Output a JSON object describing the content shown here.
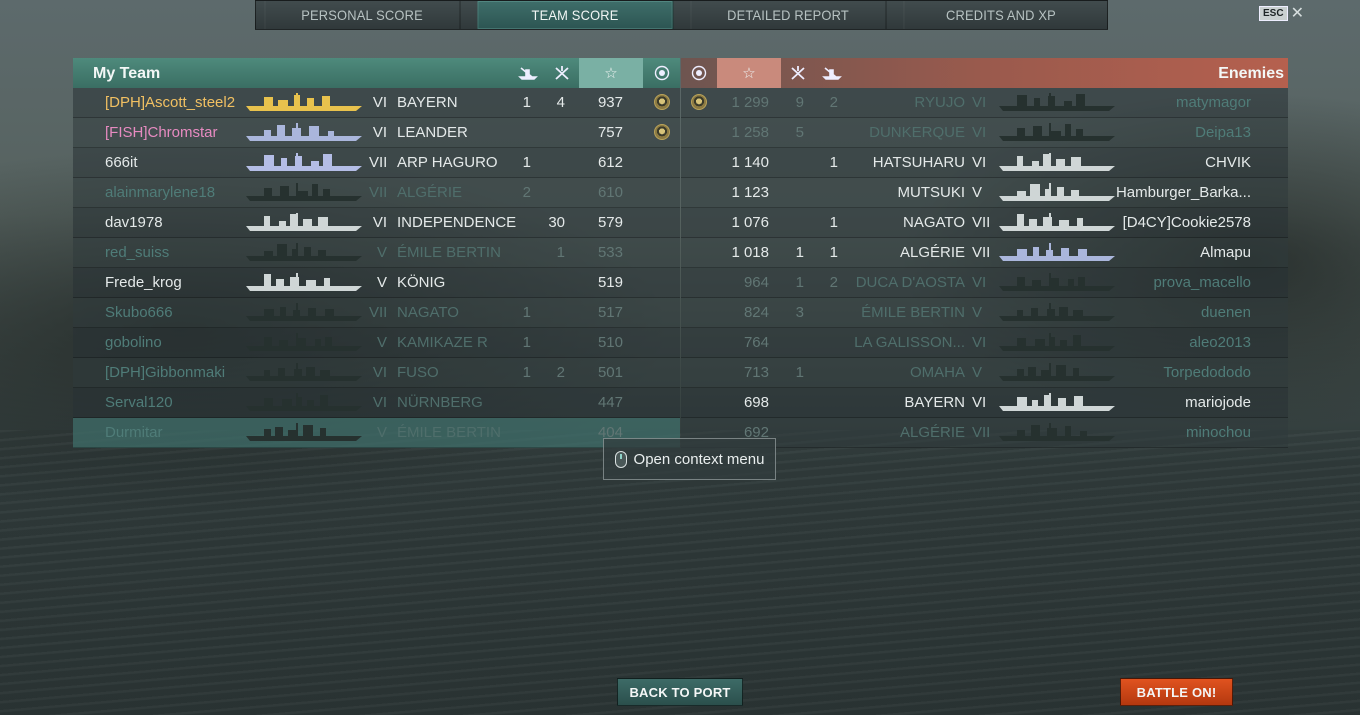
{
  "tabs": [
    {
      "label": "PERSONAL SCORE",
      "active": false
    },
    {
      "label": "TEAM SCORE",
      "active": true
    },
    {
      "label": "DETAILED REPORT",
      "active": false
    },
    {
      "label": "CREDITS AND XP",
      "active": false
    }
  ],
  "esc_label": "ESC",
  "my_team": {
    "title": "My Team",
    "columns": [
      "ships-destroyed-icon",
      "planes-destroyed-icon",
      "star-icon",
      "medal-icon"
    ],
    "rows": [
      {
        "player": "[DPH]Ascott_steel2",
        "tier": "VI",
        "ship": "BAYERN",
        "kills": "1",
        "planes": "4",
        "score": "937",
        "medal": true,
        "dead": false,
        "player_color": "orange",
        "ship_color": "gold"
      },
      {
        "player": "[FISH]Chromstar",
        "tier": "VI",
        "ship": "LEANDER",
        "kills": "",
        "planes": "",
        "score": "757",
        "medal": true,
        "dead": false,
        "player_color": "pink",
        "ship_color": "blue"
      },
      {
        "player": "666it",
        "tier": "VII",
        "ship": "ARP HAGURO",
        "kills": "1",
        "planes": "",
        "score": "612",
        "medal": false,
        "dead": false,
        "player_color": "white",
        "ship_color": "lav"
      },
      {
        "player": "alainmarylene18",
        "tier": "VII",
        "ship": "ALGÉRIE",
        "kills": "2",
        "planes": "",
        "score": "610",
        "medal": false,
        "dead": true,
        "player_color": "white",
        "ship_color": "grey"
      },
      {
        "player": "dav1978",
        "tier": "VI",
        "ship": "INDEPENDENCE",
        "kills": "",
        "planes": "30",
        "score": "579",
        "medal": false,
        "dead": false,
        "player_color": "white",
        "ship_color": "white"
      },
      {
        "player": "red_suiss",
        "tier": "V",
        "ship": "ÉMILE BERTIN",
        "kills": "",
        "planes": "1",
        "score": "533",
        "medal": false,
        "dead": true,
        "player_color": "white",
        "ship_color": "grey"
      },
      {
        "player": "Frede_krog",
        "tier": "V",
        "ship": "KÖNIG",
        "kills": "",
        "planes": "",
        "score": "519",
        "medal": false,
        "dead": false,
        "player_color": "white",
        "ship_color": "white"
      },
      {
        "player": "Skubo666",
        "tier": "VII",
        "ship": "NAGATO",
        "kills": "1",
        "planes": "",
        "score": "517",
        "medal": false,
        "dead": true,
        "player_color": "white",
        "ship_color": "grey"
      },
      {
        "player": "gobolino",
        "tier": "V",
        "ship": "KAMIKAZE R",
        "kills": "1",
        "planes": "",
        "score": "510",
        "medal": false,
        "dead": true,
        "player_color": "white",
        "ship_color": "grey"
      },
      {
        "player": "[DPH]Gibbonmaki",
        "tier": "VI",
        "ship": "FUSO",
        "kills": "1",
        "planes": "2",
        "score": "501",
        "medal": false,
        "dead": true,
        "player_color": "white",
        "ship_color": "grey"
      },
      {
        "player": "Serval120",
        "tier": "VI",
        "ship": "NÜRNBERG",
        "kills": "",
        "planes": "",
        "score": "447",
        "medal": false,
        "dead": true,
        "player_color": "white",
        "ship_color": "grey"
      },
      {
        "player": "Durmitar",
        "tier": "V",
        "ship": "ÉMILE BERTIN",
        "kills": "",
        "planes": "",
        "score": "404",
        "medal": false,
        "dead": true,
        "player_color": "white",
        "ship_color": "grey",
        "self": true
      }
    ]
  },
  "enemies": {
    "title": "Enemies",
    "columns": [
      "medal-icon",
      "star-icon",
      "planes-destroyed-icon",
      "ships-destroyed-icon"
    ],
    "rows": [
      {
        "player": "matymagor",
        "tier": "VI",
        "ship": "RYUJO",
        "kills": "2",
        "planes": "9",
        "score": "1 299",
        "medal": true,
        "dead": true,
        "ship_color": "grey"
      },
      {
        "player": "Deipa13",
        "tier": "VI",
        "ship": "DUNKERQUE",
        "kills": "",
        "planes": "5",
        "score": "1 258",
        "medal": false,
        "dead": true,
        "ship_color": "grey"
      },
      {
        "player": "CHVIK",
        "tier": "VI",
        "ship": "HATSUHARU",
        "kills": "1",
        "planes": "",
        "score": "1 140",
        "medal": false,
        "dead": false,
        "ship_color": "white"
      },
      {
        "player": "Hamburger_Barka...",
        "tier": "V",
        "ship": "MUTSUKI",
        "kills": "",
        "planes": "",
        "score": "1 123",
        "medal": false,
        "dead": false,
        "ship_color": "white"
      },
      {
        "player": "[D4CY]Cookie2578",
        "tier": "VII",
        "ship": "NAGATO",
        "kills": "1",
        "planes": "",
        "score": "1 076",
        "medal": false,
        "dead": false,
        "ship_color": "white"
      },
      {
        "player": "Almapu",
        "tier": "VII",
        "ship": "ALGÉRIE",
        "kills": "1",
        "planes": "1",
        "score": "1 018",
        "medal": false,
        "dead": false,
        "ship_color": "blue"
      },
      {
        "player": "prova_macello",
        "tier": "VI",
        "ship": "DUCA D'AOSTA",
        "kills": "2",
        "planes": "1",
        "score": "964",
        "medal": false,
        "dead": true,
        "ship_color": "grey"
      },
      {
        "player": "duenen",
        "tier": "V",
        "ship": "ÉMILE BERTIN",
        "kills": "",
        "planes": "3",
        "score": "824",
        "medal": false,
        "dead": true,
        "ship_color": "grey"
      },
      {
        "player": "aleo2013",
        "tier": "VI",
        "ship": "LA GALISSON...",
        "kills": "",
        "planes": "",
        "score": "764",
        "medal": false,
        "dead": true,
        "ship_color": "grey"
      },
      {
        "player": "Torpedododo",
        "tier": "V",
        "ship": "OMAHA",
        "kills": "",
        "planes": "1",
        "score": "713",
        "medal": false,
        "dead": true,
        "ship_color": "grey"
      },
      {
        "player": "mariojode",
        "tier": "VI",
        "ship": "BAYERN",
        "kills": "",
        "planes": "",
        "score": "698",
        "medal": false,
        "dead": false,
        "ship_color": "white"
      },
      {
        "player": "minochou",
        "tier": "VII",
        "ship": "ALGÉRIE",
        "kills": "",
        "planes": "",
        "score": "692",
        "medal": false,
        "dead": true,
        "ship_color": "grey"
      }
    ]
  },
  "context_menu_label": "Open context menu",
  "back_to_port_label": "BACK TO PORT",
  "battle_label": "BATTLE ON!"
}
